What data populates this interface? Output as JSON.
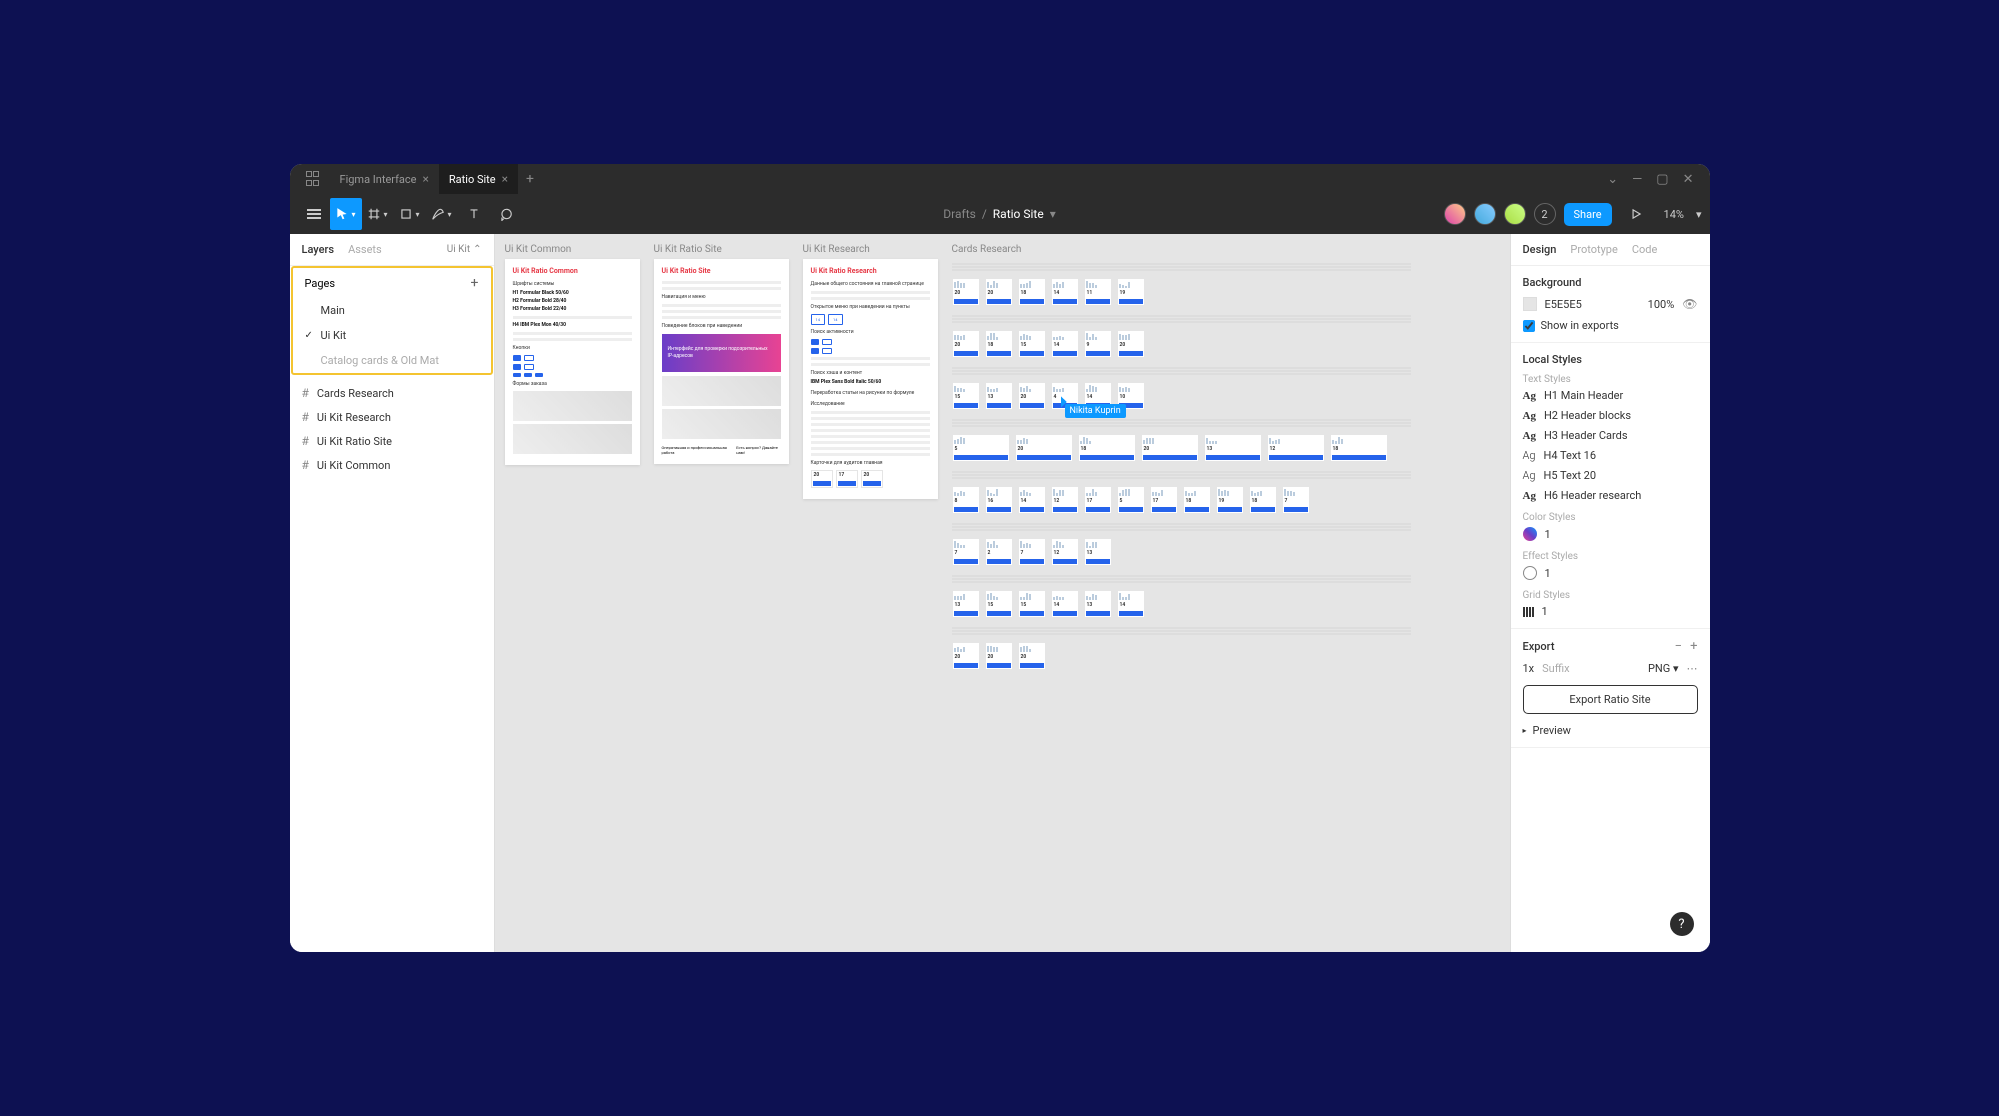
{
  "titlebar": {
    "tab1": "Figma Interface",
    "tab2": "Ratio Site"
  },
  "toolbar": {
    "path": "Drafts",
    "sep": "/",
    "filename": "Ratio Site",
    "user_count": "2",
    "share": "Share",
    "zoom": "14%"
  },
  "left": {
    "tabs": {
      "layers": "Layers",
      "assets": "Assets"
    },
    "page_selector": "Ui Kit",
    "pages_label": "Pages",
    "pages": {
      "p0": "Main",
      "p1": "Ui Kit",
      "p2": "Catalog cards & Old Mat"
    },
    "frames": {
      "f0": "Cards Research",
      "f1": "Ui Kit Research",
      "f2": "Ui Kit Ratio Site",
      "f3": "Ui Kit Common"
    }
  },
  "canvas": {
    "labels": {
      "a1": "Ui Kit Common",
      "a2": "Ui Kit Ratio Site",
      "a3": "Ui Kit Research",
      "a4": "Cards Research"
    },
    "artboard1_title": "Ui Kit Ratio Common",
    "artboard2_title": "Ui Kit Ratio Site",
    "artboard3_title": "Ui Kit Ratio Research",
    "typo": {
      "h1": "H1 Formular Black 50/60",
      "h2": "H2 Formular Bold 28/40",
      "h3": "H3 Formular Bold 22/40",
      "h4": "H4 IBM Plex Mon 40/30",
      "ibm": "IBM Plex Sans Bold Italic 50/60"
    },
    "cursor_user": "Nikita Kuprin",
    "card_numbers": [
      "20",
      "20",
      "18",
      "14",
      "11",
      "19",
      "20",
      "18",
      "15",
      "14",
      "9",
      "20",
      "15",
      "13",
      "20",
      "4",
      "14",
      "10",
      "5",
      "20",
      "18",
      "20",
      "13",
      "12",
      "18",
      "8",
      "16",
      "14",
      "12",
      "17",
      "5",
      "17",
      "18",
      "19",
      "18",
      "7",
      "7",
      "2",
      "7",
      "12",
      "13",
      "13",
      "15",
      "15",
      "14",
      "13",
      "14",
      "20",
      "20",
      "20"
    ]
  },
  "right": {
    "tabs": {
      "design": "Design",
      "prototype": "Prototype",
      "code": "Code"
    },
    "bg_label": "Background",
    "bg_hex": "E5E5E5",
    "bg_pct": "100%",
    "show_exports": "Show in exports",
    "local_styles": "Local Styles",
    "text_styles_label": "Text Styles",
    "text_styles": {
      "t0": "H1 Main Header",
      "t1": "H2 Header blocks",
      "t2": "H3 Header Cards",
      "t3": "H4 Text 16",
      "t4": "H5 Text 20",
      "t5": "H6 Header research"
    },
    "color_styles_label": "Color Styles",
    "color_style_name": "1",
    "effect_styles_label": "Effect Styles",
    "effect_style_name": "1",
    "grid_styles_label": "Grid Styles",
    "grid_style_name": "1",
    "export_label": "Export",
    "export_scale": "1x",
    "export_suffix_label": "Suffix",
    "export_format": "PNG",
    "export_button": "Export Ratio Site",
    "preview": "Preview"
  },
  "help": "?"
}
